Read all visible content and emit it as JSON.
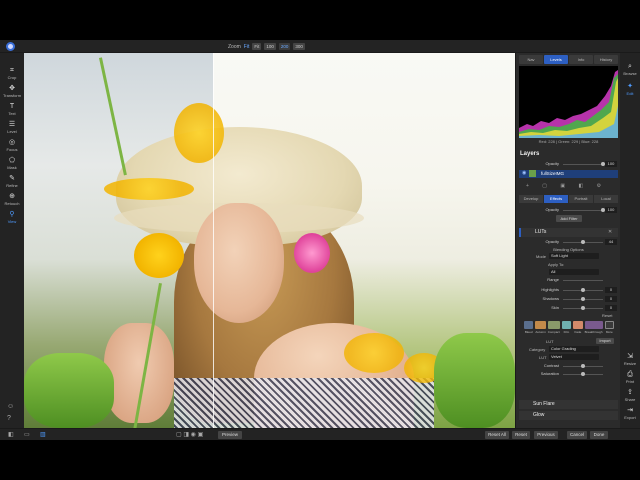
{
  "topbar": {
    "zoom_label": "Zoom",
    "zoom_value": "Fit",
    "zoom_buttons": [
      "Fit",
      "100",
      "200",
      "300"
    ]
  },
  "tools": [
    {
      "label": "Crop",
      "icon": "crop-icon",
      "glyph": "⌗"
    },
    {
      "label": "Transform",
      "icon": "transform-icon",
      "glyph": "✥"
    },
    {
      "label": "Text",
      "icon": "text-icon",
      "glyph": "T"
    },
    {
      "label": "Level",
      "icon": "level-icon",
      "glyph": "☰"
    },
    {
      "label": "Focus",
      "icon": "focus-icon",
      "glyph": "◎"
    },
    {
      "label": "Mask",
      "icon": "mask-icon",
      "glyph": "⬠"
    },
    {
      "label": "Refine",
      "icon": "refine-icon",
      "glyph": "✎"
    },
    {
      "label": "Retouch",
      "icon": "retouch-icon",
      "glyph": "⊕"
    },
    {
      "label": "View",
      "icon": "view-icon",
      "glyph": "⚲"
    }
  ],
  "panel": {
    "header_tabs": [
      "Nav",
      "Levels",
      "Info",
      "History"
    ],
    "active_header_tab": 1,
    "histogram_readout": "Red: 228 | Green: 229 | Blue: 228",
    "layers_title": "Layers",
    "opacity_label": "Opacity",
    "opacity_value": "100",
    "layer_name": "fullSizeIMG",
    "effect_tabs": [
      "Develop",
      "Effects",
      "Portrait",
      "Local"
    ],
    "active_effect_tab": 1,
    "effects_opacity_label": "Opacity",
    "effects_opacity_value": "100",
    "add_filter_label": "Add Filter",
    "luts": {
      "title": "LUTs",
      "opacity_label": "Opacity",
      "opacity_value": "44",
      "blending_label": "Blending Options",
      "mode_label": "Mode",
      "mode_value": "Soft Light",
      "apply_to_label": "Apply To:",
      "apply_to_value": "All",
      "range_label": "Range",
      "sliders": [
        {
          "label": "Highlights",
          "value": "0"
        },
        {
          "label": "Shadows",
          "value": "0"
        },
        {
          "label": "Skin",
          "value": "0"
        }
      ],
      "reset_label": "Reset",
      "thumbs": [
        {
          "label": "Bleed",
          "color": "#5a6f8e"
        },
        {
          "label": "Autumn",
          "color": "#c28a4a"
        },
        {
          "label": "Compact",
          "color": "#8a9a6a"
        },
        {
          "label": "Film",
          "color": "#6fb0b0"
        },
        {
          "label": "Fade",
          "color": "#d38a6a"
        },
        {
          "label": "Breakthrough",
          "color": "#7a5a8e"
        },
        {
          "label": "More",
          "color": "#3a3a3a"
        }
      ],
      "lut_label": "LUT",
      "import_label": "Import",
      "category_label": "Category",
      "category_value": "Color Grading",
      "lut_value_label": "LUT",
      "lut_value": "Velvet",
      "contrast_label": "Contrast",
      "saturation_label": "Saturation"
    },
    "filters": [
      {
        "name": "Sun Flare",
        "icon": "sun-flare-icon"
      },
      {
        "name": "Glow",
        "icon": "glow-icon"
      }
    ]
  },
  "right_tools": [
    {
      "label": "Browse",
      "icon": "browse-icon",
      "glyph": "⌕"
    },
    {
      "label": "Edit",
      "icon": "edit-icon",
      "glyph": "✦"
    },
    {
      "label": "Resize",
      "icon": "resize-icon",
      "glyph": "⇲"
    },
    {
      "label": "Print",
      "icon": "print-icon",
      "glyph": "⎙"
    },
    {
      "label": "Share",
      "icon": "share-icon",
      "glyph": "⇪"
    },
    {
      "label": "Export",
      "icon": "export-icon",
      "glyph": "⇥"
    }
  ],
  "bottombar": {
    "preview_label": "Preview",
    "reset_all_label": "Reset All",
    "reset_label": "Reset",
    "previous_label": "Previous",
    "cancel_label": "Cancel",
    "done_label": "Done"
  }
}
